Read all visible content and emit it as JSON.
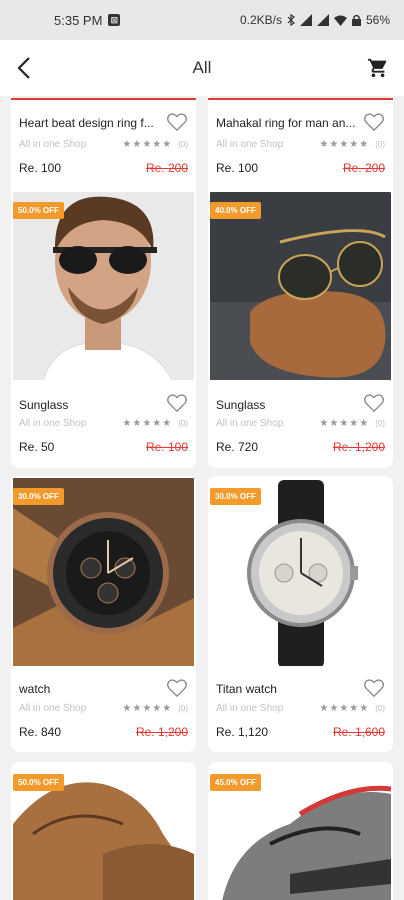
{
  "status": {
    "time": "5:35 PM",
    "speed": "0.2KB/s",
    "battery": "56%"
  },
  "header": {
    "title": "All"
  },
  "products": [
    {
      "name": "Heart beat design ring f...",
      "shop": "All in one Shop",
      "rating_count": "(0)",
      "price": "Re. 100",
      "old_price": "Re. 200",
      "badge": ""
    },
    {
      "name": "Mahakal ring for man an...",
      "shop": "All in one Shop",
      "rating_count": "(0)",
      "price": "Re. 100",
      "old_price": "Re. 200",
      "badge": ""
    },
    {
      "name": "Sunglass",
      "shop": "All in one Shop",
      "rating_count": "(0)",
      "price": "Re. 50",
      "old_price": "Re. 100",
      "badge": "50.0% OFF"
    },
    {
      "name": "Sunglass",
      "shop": "All in one Shop",
      "rating_count": "(0)",
      "price": "Re. 720",
      "old_price": "Re. 1,200",
      "badge": "40.0% OFF"
    },
    {
      "name": "watch",
      "shop": "All in one Shop",
      "rating_count": "(0)",
      "price": "Re. 840",
      "old_price": "Re. 1,200",
      "badge": "30.0% OFF"
    },
    {
      "name": "Titan watch",
      "shop": "All in one Shop",
      "rating_count": "(0)",
      "price": "Re. 1,120",
      "old_price": "Re. 1,600",
      "badge": "30.0% OFF"
    },
    {
      "name": "",
      "shop": "",
      "rating_count": "",
      "price": "",
      "old_price": "",
      "badge": "50.0% OFF"
    },
    {
      "name": "",
      "shop": "",
      "rating_count": "",
      "price": "",
      "old_price": "",
      "badge": "45.0% OFF"
    }
  ],
  "colors": {
    "accent": "#f29a2b",
    "old_price": "#e53935"
  }
}
